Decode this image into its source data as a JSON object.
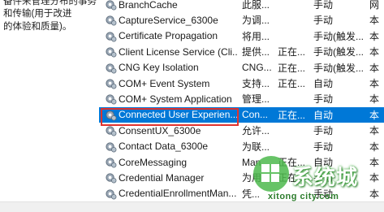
{
  "left_description": [
    "备件来管理分布的事务",
    "和传输(用于改进",
    "的体验和质量)。"
  ],
  "services": [
    {
      "name": "BranchCache",
      "desc": "此服...",
      "status": "",
      "startup": "手动",
      "logon": "网"
    },
    {
      "name": "CaptureService_6300e",
      "desc": "为调...",
      "status": "",
      "startup": "手动",
      "logon": "本"
    },
    {
      "name": "Certificate Propagation",
      "desc": "将用...",
      "status": "",
      "startup": "手动(触发...",
      "logon": "本"
    },
    {
      "name": "Client License Service (Cli...",
      "desc": "提供...",
      "status": "正在...",
      "startup": "手动(触发...",
      "logon": "本"
    },
    {
      "name": "CNG Key Isolation",
      "desc": "CNG...",
      "status": "正在...",
      "startup": "手动(触发...",
      "logon": "本"
    },
    {
      "name": "COM+ Event System",
      "desc": "支持...",
      "status": "正在...",
      "startup": "自动",
      "logon": "本"
    },
    {
      "name": "COM+ System Application",
      "desc": "管理...",
      "status": "",
      "startup": "手动",
      "logon": "本"
    },
    {
      "name": "Connected User Experien...",
      "desc": "Con...",
      "status": "正在...",
      "startup": "自动",
      "logon": "本"
    },
    {
      "name": "ConsentUX_6300e",
      "desc": "允许...",
      "status": "",
      "startup": "手动",
      "logon": "本"
    },
    {
      "name": "Contact Data_6300e",
      "desc": "为联...",
      "status": "",
      "startup": "手动",
      "logon": "本"
    },
    {
      "name": "CoreMessaging",
      "desc": "Man...",
      "status": "正在...",
      "startup": "自动",
      "logon": "本"
    },
    {
      "name": "Credential Manager",
      "desc": "为用...",
      "status": "正在...",
      "startup": "手动",
      "logon": "本"
    },
    {
      "name": "CredentialEnrollmentMan...",
      "desc": "凭...",
      "status": "",
      "startup": "手动",
      "logon": "本"
    }
  ],
  "selected_index": 7,
  "watermark": {
    "text": "系统城",
    "url": "xitong city.com"
  },
  "colors": {
    "selection": "#0078d7",
    "highlight_border": "#e0332e"
  }
}
